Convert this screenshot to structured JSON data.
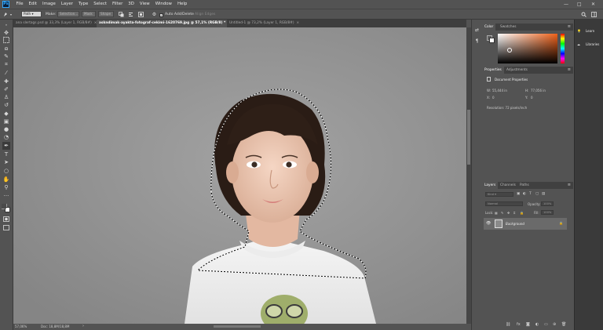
{
  "app": {
    "logo": "Ps"
  },
  "menubar": {
    "items": [
      "File",
      "Edit",
      "Image",
      "Layer",
      "Type",
      "Select",
      "Filter",
      "3D",
      "View",
      "Window",
      "Help"
    ],
    "window_controls": {
      "minimize": "—",
      "maximize": "□",
      "close": "✕"
    }
  },
  "options": {
    "mode_value": "Path",
    "make_label": "Make:",
    "selection_label": "Selection...",
    "mask_label": "Mask",
    "shape_label": "Shape",
    "auto_add_delete": "Auto Add/Delete",
    "auto_add_checked": true,
    "align_edges": "Align Edges"
  },
  "tabs": [
    {
      "label": "ana slertags.psd @ 33,3% (Layer 1, RGB/8#)",
      "close": "×"
    },
    {
      "label": "askndimak-ayakta-fotograf-cekimi-1620769.jpg @ 57,1% (RGB/8) *",
      "close": "×"
    },
    {
      "label": "Untitled-1 @ 73,2% (Layer 1, RGB/8#)",
      "close": "×"
    }
  ],
  "status": {
    "zoom": "57,06%",
    "doc": "Doc: 18,8M/18,8M"
  },
  "color_panel": {
    "tabs": [
      "Color",
      "Swatches"
    ],
    "fg": "#5e5e5e",
    "bg": "#ffffff"
  },
  "properties_panel": {
    "tabs": [
      "Properties",
      "Adjustments"
    ],
    "section": "Document Properties",
    "w_label": "W:",
    "w_value": "55,444 in",
    "h_label": "H:",
    "h_value": "77,056 in",
    "x_label": "X:",
    "x_value": "0",
    "y_label": "Y:",
    "y_value": "0",
    "resolution": "Resolution: 72 pixels/inch"
  },
  "layers_panel": {
    "tabs": [
      "Layers",
      "Channels",
      "Paths"
    ],
    "kind_label": "Kind",
    "blend_mode": "Normal",
    "opacity_label": "Opacity:",
    "opacity_value": "100%",
    "lock_label": "Lock:",
    "fill_label": "Fill:",
    "fill_value": "100%",
    "layers": [
      {
        "name": "Background",
        "visible": true,
        "locked": true
      }
    ]
  },
  "libraries": {
    "items": [
      "Learn",
      "Libraries"
    ]
  },
  "colors": {
    "ui_bg": "#535353",
    "ui_dark": "#404040",
    "accent": "#31a8ff"
  }
}
